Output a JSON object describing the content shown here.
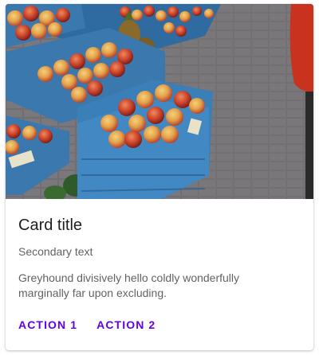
{
  "card": {
    "image_alt": "Crates of apples and fruit at a market stall",
    "title": "Card title",
    "subtitle": "Secondary text",
    "body": "Greyhound divisively hello coldly wonderfully marginally far upon excluding.",
    "actions": [
      {
        "label": "ACTION 1"
      },
      {
        "label": "ACTION 2"
      }
    ]
  },
  "colors": {
    "accent": "#6200ee",
    "title_text": "#1f1f1f",
    "secondary_text": "#5f6368",
    "crate_blue": "#3a78ae",
    "pavement": "#6f6f72"
  }
}
